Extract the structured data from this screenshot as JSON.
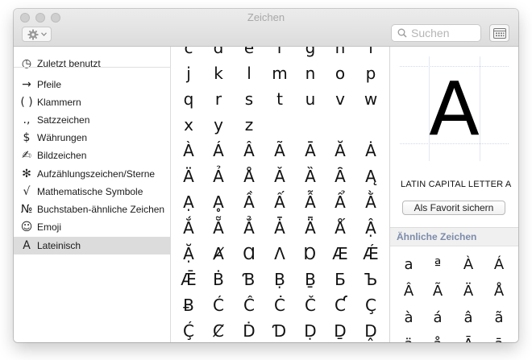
{
  "window": {
    "title": "Zeichen"
  },
  "toolbar": {
    "gear_icon": "gear-icon",
    "search_placeholder": "Suchen",
    "search_value": ""
  },
  "sidebar": {
    "items": [
      {
        "label": "Zuletzt benutzt",
        "icon": "◷",
        "icon_name": "clock-icon"
      },
      {
        "label": "Pfeile",
        "icon": "→",
        "icon_name": "arrow-icon"
      },
      {
        "label": "Klammern",
        "icon": "( )",
        "icon_name": "parentheses-icon"
      },
      {
        "label": "Satzzeichen",
        "icon": ".,",
        "icon_name": "punctuation-icon"
      },
      {
        "label": "Währungen",
        "icon": "$",
        "icon_name": "dollar-icon"
      },
      {
        "label": "Bildzeichen",
        "icon": "✍",
        "icon_name": "writing-hand-icon"
      },
      {
        "label": "Aufzählungszeichen/Sterne",
        "icon": "✻",
        "icon_name": "asterisk-icon"
      },
      {
        "label": "Mathematische Symbole",
        "icon": "√",
        "icon_name": "square-root-icon"
      },
      {
        "label": "Buchstaben-ähnliche Zeichen",
        "icon": "№",
        "icon_name": "numero-icon"
      },
      {
        "label": "Emoji",
        "icon": "☺",
        "icon_name": "smiley-icon"
      },
      {
        "label": "Lateinisch",
        "icon": "A",
        "icon_name": "latin-a-icon"
      }
    ],
    "selected_index": 10
  },
  "grid": {
    "rows": [
      [
        "c",
        "d",
        "e",
        "f",
        "g",
        "h",
        "i"
      ],
      [
        "j",
        "k",
        "l",
        "m",
        "n",
        "o",
        "p"
      ],
      [
        "q",
        "r",
        "s",
        "t",
        "u",
        "v",
        "w"
      ],
      [
        "x",
        "y",
        "z"
      ],
      [
        "À",
        "Á",
        "Â",
        "Ã",
        "Ā",
        "Ă",
        "Ȧ"
      ],
      [
        "Ä",
        "Ả",
        "Å",
        "Ǎ",
        "Ȁ",
        "Ȃ",
        "Ą"
      ],
      [
        "Ạ",
        "Ḁ",
        "Ầ",
        "Ấ",
        "Ẫ",
        "Ẩ",
        "Ằ"
      ],
      [
        "Ắ",
        "Ẵ",
        "Ẳ",
        "Ǡ",
        "Ǟ",
        "Ǻ",
        "Ậ"
      ],
      [
        "Ặ",
        "Ⱥ",
        "Ɑ",
        "Ʌ",
        "Ɒ",
        "Æ",
        "Ǽ"
      ],
      [
        "Ǣ",
        "Ḃ",
        "Ɓ",
        "Ḅ",
        "Ḇ",
        "Б",
        "Ъ"
      ],
      [
        "Ƀ",
        "Ć",
        "Ĉ",
        "Ċ",
        "Č",
        "Ƈ",
        "Ç"
      ],
      [
        "Ḉ",
        "Ȼ",
        "Ḋ",
        "Ɗ",
        "Ḍ",
        "Ḏ",
        "Ḓ"
      ]
    ]
  },
  "detail": {
    "preview_char": "A",
    "char_name": "LATIN CAPITAL LETTER A",
    "favorite_button": "Als Favorit sichern",
    "similar_header": "Ähnliche Zeichen",
    "similar_rows": [
      [
        "a",
        "ª",
        "À",
        "Á"
      ],
      [
        "Â",
        "Ã",
        "Ä",
        "Å"
      ],
      [
        "à",
        "á",
        "â",
        "ã"
      ],
      [
        "ä",
        "å",
        "Ā",
        "ā"
      ]
    ]
  }
}
